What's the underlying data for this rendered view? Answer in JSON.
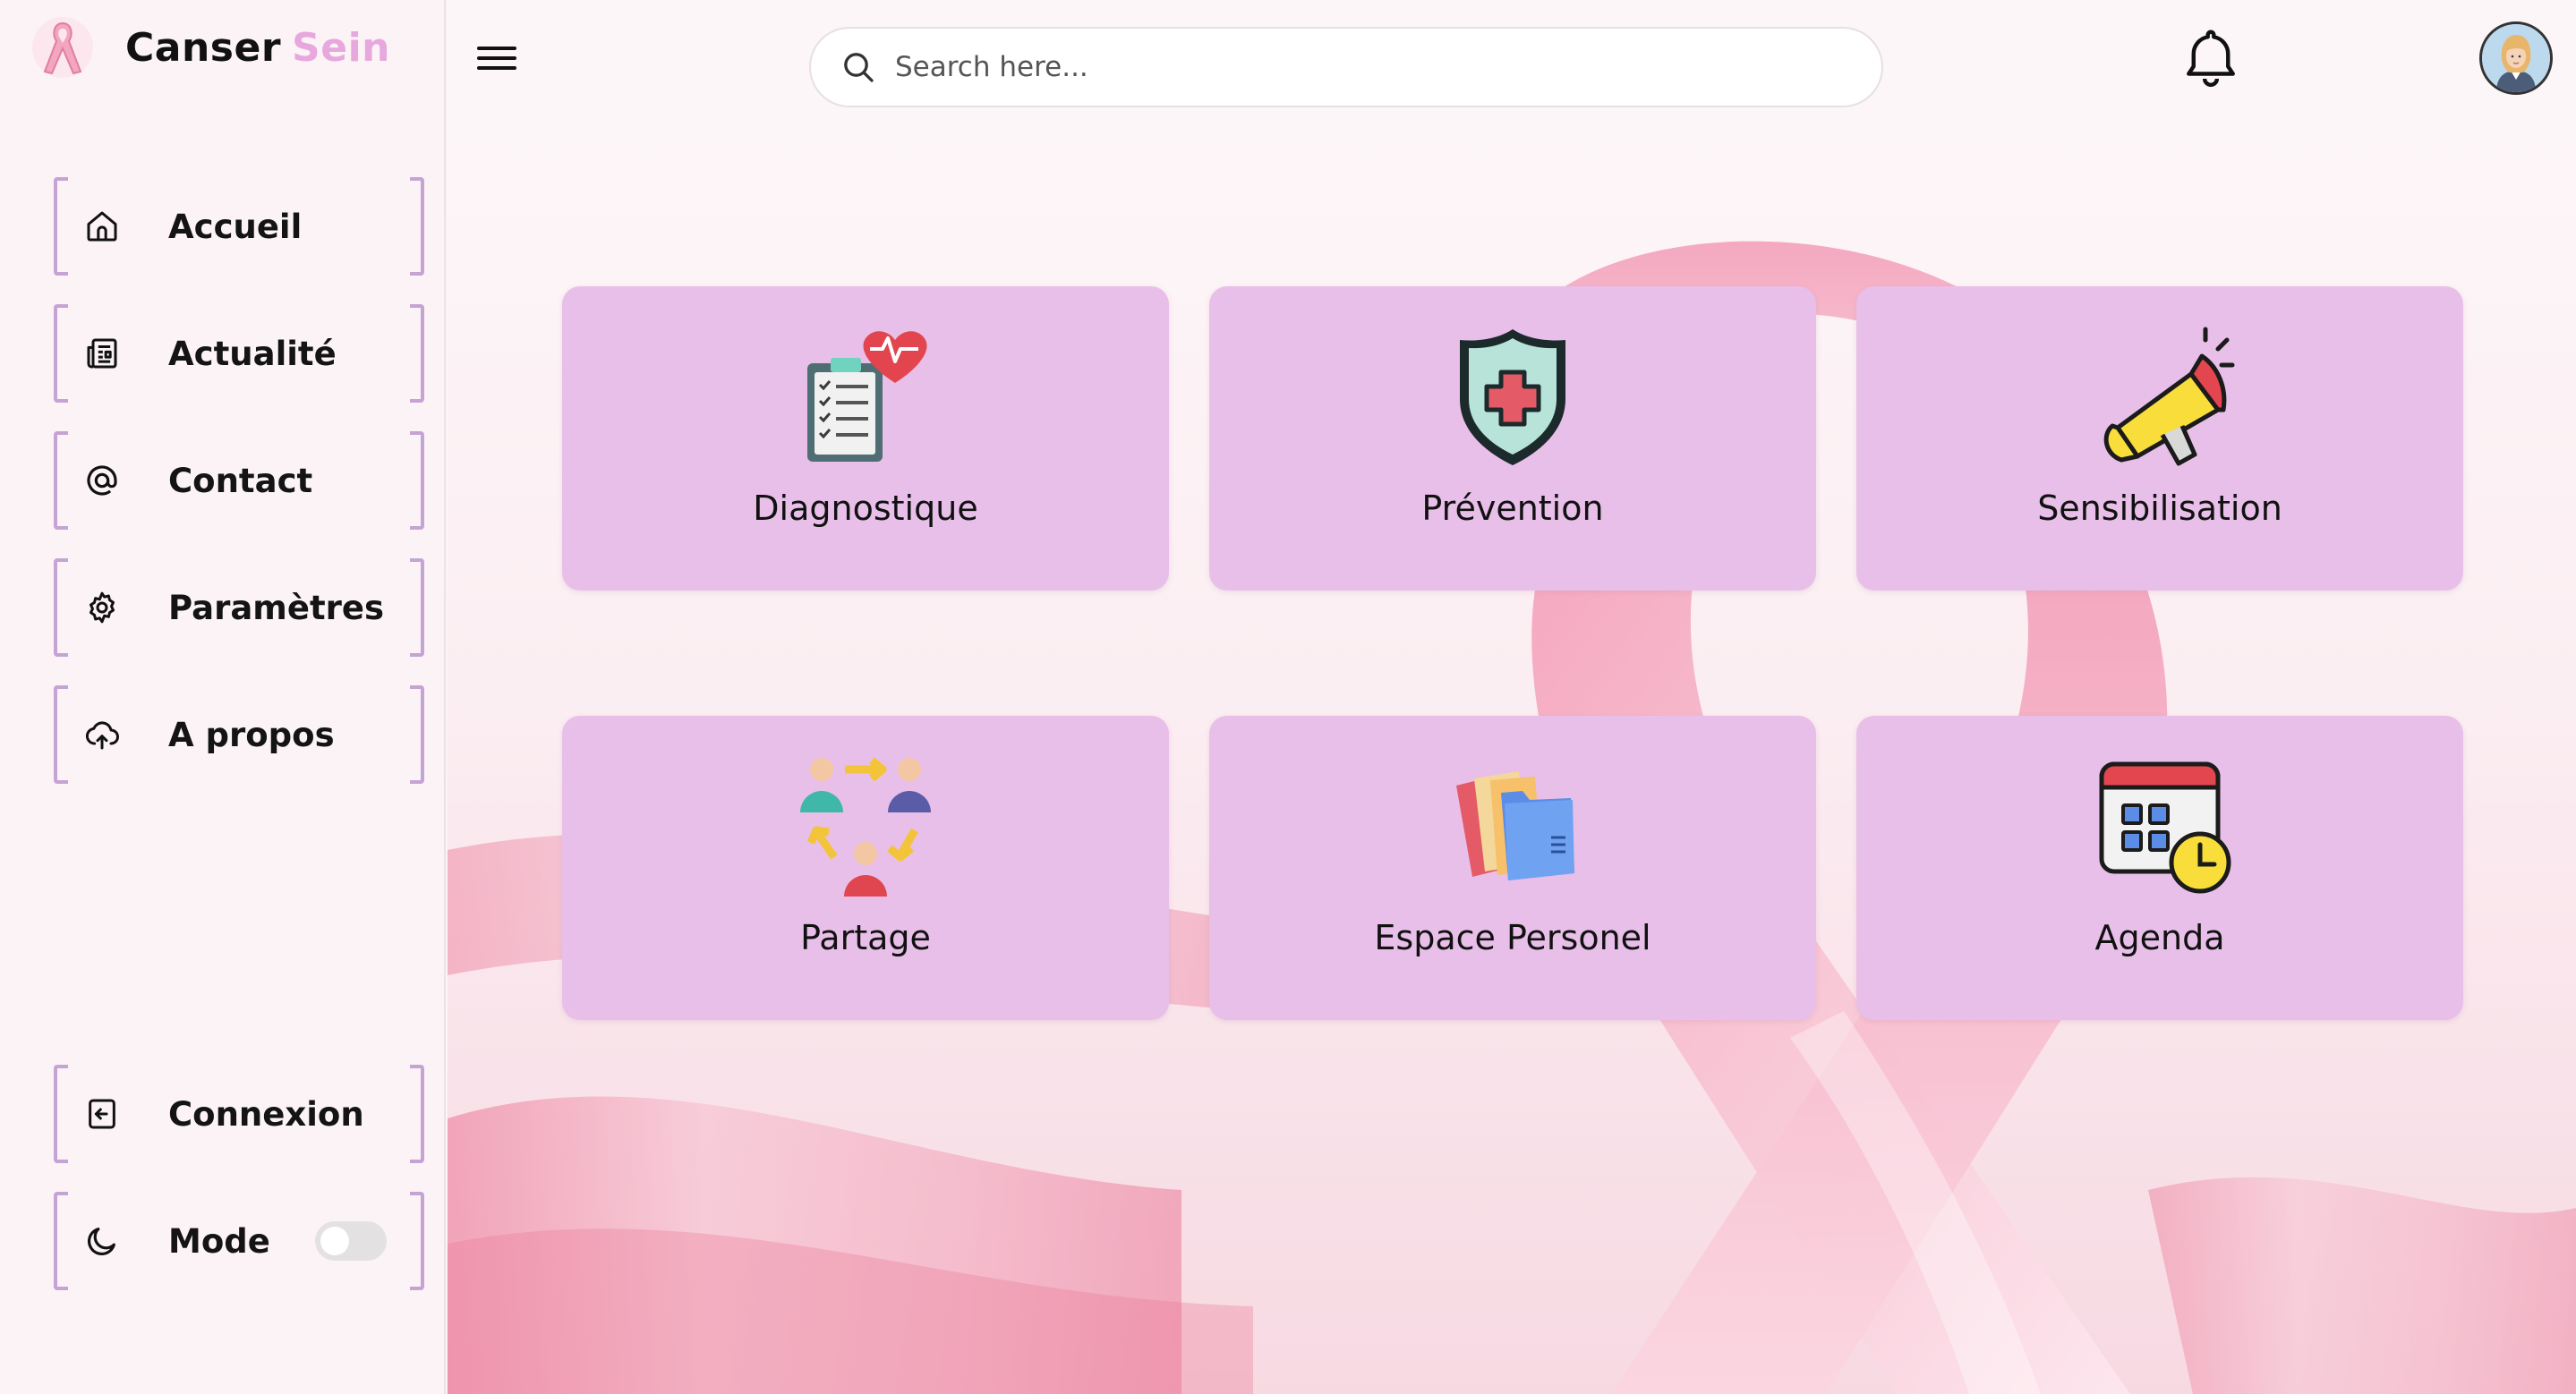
{
  "brand": {
    "name": "Canser",
    "accent": "Sein"
  },
  "sidebar": {
    "items": [
      {
        "label": "Accueil",
        "icon": "home-icon"
      },
      {
        "label": "Actualité",
        "icon": "newspaper-icon"
      },
      {
        "label": "Contact",
        "icon": "at-icon"
      },
      {
        "label": "Paramètres",
        "icon": "gear-icon"
      },
      {
        "label": "A propos",
        "icon": "cloud-upload-icon"
      }
    ],
    "bottom": [
      {
        "label": "Connexion",
        "icon": "login-icon"
      },
      {
        "label": "Mode",
        "icon": "moon-icon",
        "toggle": false
      }
    ]
  },
  "header": {
    "search_placeholder": "Search here...",
    "menu_icon": "hamburger-icon",
    "notification_icon": "bell-icon",
    "avatar_icon": "user-avatar"
  },
  "cards": [
    {
      "label": "Diagnostique",
      "icon": "clipboard-heart-icon"
    },
    {
      "label": "Prévention",
      "icon": "shield-cross-icon"
    },
    {
      "label": "Sensibilisation",
      "icon": "megaphone-icon"
    },
    {
      "label": "Partage",
      "icon": "people-share-icon"
    },
    {
      "label": "Espace Personel",
      "icon": "folders-icon"
    },
    {
      "label": "Agenda",
      "icon": "calendar-clock-icon"
    }
  ],
  "colors": {
    "accent": "#e7a8dd",
    "card": "#e8bfe8",
    "nav_border": "#c5a3d4",
    "ribbon": "#f09bb5"
  }
}
